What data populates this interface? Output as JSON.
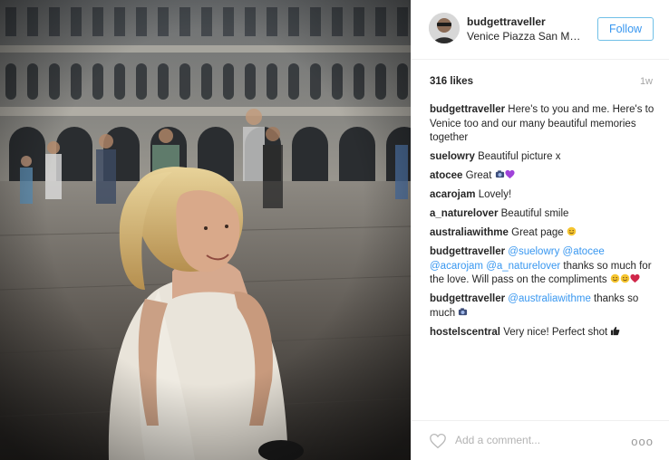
{
  "post": {
    "username": "budgettraveller",
    "location": "Venice Piazza San Marco",
    "follow_label": "Follow",
    "likes": "316 likes",
    "time": "1w"
  },
  "comments": [
    {
      "user": "budgettraveller",
      "parts": [
        {
          "t": "text",
          "v": "Here's to you and me. Here's to Venice too and our many beautiful memories together"
        }
      ]
    },
    {
      "user": "suelowry",
      "parts": [
        {
          "t": "text",
          "v": "Beautiful picture x"
        }
      ]
    },
    {
      "user": "atocee",
      "parts": [
        {
          "t": "text",
          "v": "Great "
        },
        {
          "t": "emoji",
          "v": "camera-emoji"
        },
        {
          "t": "emoji",
          "v": "purple-heart-emoji"
        }
      ]
    },
    {
      "user": "acarojam",
      "parts": [
        {
          "t": "text",
          "v": "Lovely!"
        }
      ]
    },
    {
      "user": "a_naturelover",
      "parts": [
        {
          "t": "text",
          "v": "Beautiful smile"
        }
      ]
    },
    {
      "user": "australiawithme",
      "parts": [
        {
          "t": "text",
          "v": "Great page "
        },
        {
          "t": "emoji",
          "v": "smile-emoji"
        }
      ]
    },
    {
      "user": "budgettraveller",
      "parts": [
        {
          "t": "mention",
          "v": "@suelowry"
        },
        {
          "t": "text",
          "v": " "
        },
        {
          "t": "mention",
          "v": "@atocee"
        },
        {
          "t": "text",
          "v": " "
        },
        {
          "t": "mention",
          "v": "@acarojam"
        },
        {
          "t": "text",
          "v": " "
        },
        {
          "t": "mention",
          "v": "@a_naturelover"
        },
        {
          "t": "text",
          "v": " thanks so much for the love. Will pass on the compliments "
        },
        {
          "t": "emoji",
          "v": "smile-emoji"
        },
        {
          "t": "emoji",
          "v": "smile-emoji"
        },
        {
          "t": "emoji",
          "v": "hearts-emoji"
        }
      ]
    },
    {
      "user": "budgettraveller",
      "parts": [
        {
          "t": "mention",
          "v": "@australiawithme"
        },
        {
          "t": "text",
          "v": " thanks so much "
        },
        {
          "t": "emoji",
          "v": "camera-emoji"
        }
      ]
    },
    {
      "user": "hostelscentral",
      "parts": [
        {
          "t": "text",
          "v": "Very nice! Perfect shot "
        },
        {
          "t": "emoji",
          "v": "thumbs-up-emoji"
        }
      ]
    }
  ],
  "footer": {
    "add_comment_placeholder": "Add a comment...",
    "more_label": "ooo",
    "like_icon": "heart-outline-icon"
  },
  "photo": {
    "description_icon": "photo-image"
  }
}
